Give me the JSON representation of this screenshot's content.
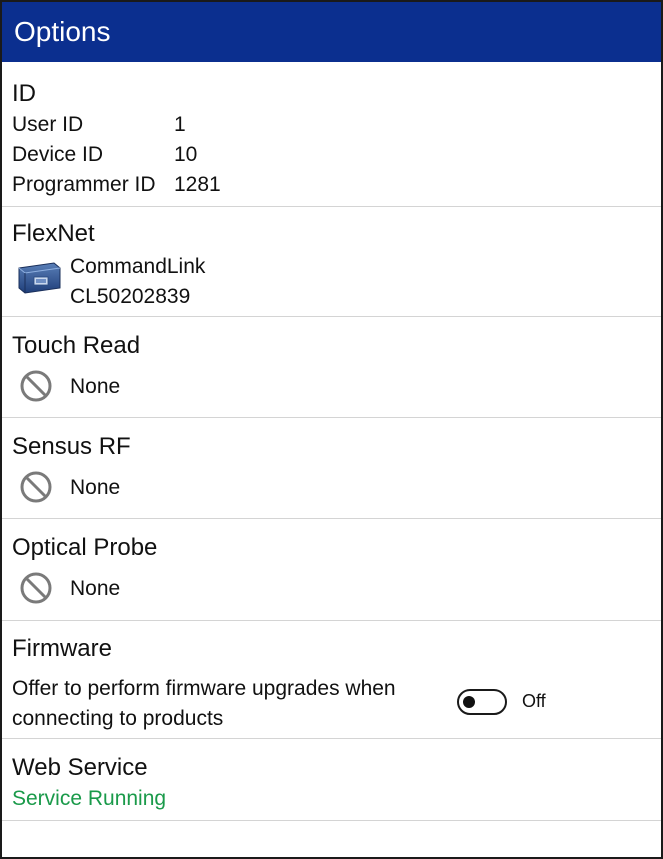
{
  "window": {
    "title": "Options"
  },
  "id_section": {
    "heading": "ID",
    "rows": [
      {
        "label": "User ID",
        "value": "1"
      },
      {
        "label": "Device ID",
        "value": "10"
      },
      {
        "label": "Programmer ID",
        "value": "1281"
      }
    ]
  },
  "flexnet": {
    "heading": "FlexNet",
    "device_icon": "commandlink-device-icon",
    "device_name": "CommandLink",
    "device_serial": "CL50202839"
  },
  "touch_read": {
    "heading": "Touch Read",
    "icon": "none-icon",
    "value": "None"
  },
  "sensus_rf": {
    "heading": "Sensus RF",
    "icon": "none-icon",
    "value": "None"
  },
  "optical_probe": {
    "heading": "Optical Probe",
    "icon": "none-icon",
    "value": "None"
  },
  "firmware": {
    "heading": "Firmware",
    "description_line1": "Offer to perform firmware upgrades when",
    "description_line2": "connecting to products",
    "toggle_state": "Off"
  },
  "web_service": {
    "heading": "Web Service",
    "status": "Service Running",
    "status_color": "#1a9a4a"
  },
  "colors": {
    "titlebar": "#0b2f8f",
    "divider": "#d4d4d4"
  }
}
